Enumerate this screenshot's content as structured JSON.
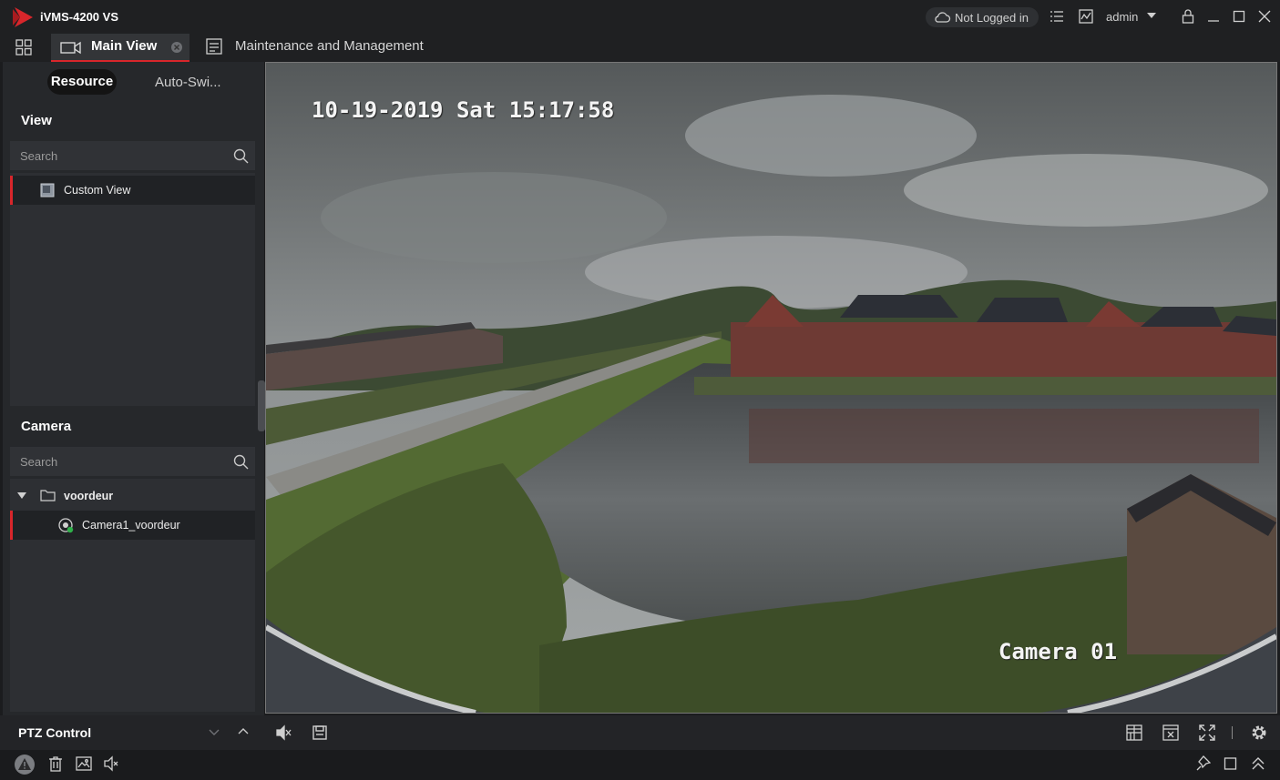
{
  "app": {
    "title": "iVMS-4200 VS",
    "brand_color": "#d8262b"
  },
  "titlebar": {
    "login_status": "Not Logged in",
    "user": "admin",
    "icons": [
      "cloud-icon",
      "task-list-icon",
      "alarm-event-icon",
      "user-dropdown-icon",
      "lock-icon",
      "minimize-icon",
      "maximize-icon",
      "close-icon"
    ]
  },
  "tabs": {
    "main_view": "Main View",
    "maintenance": "Maintenance and Management"
  },
  "left_panel": {
    "tab_resource": "Resource",
    "tab_autoswitch": "Auto-Swi...",
    "view_section": {
      "title": "View",
      "search_placeholder": "Search",
      "items": [
        {
          "label": "Custom View"
        }
      ]
    },
    "camera_section": {
      "title": "Camera",
      "search_placeholder": "Search",
      "group": "voordeur",
      "cameras": [
        {
          "label": "Camera1_voordeur"
        }
      ]
    },
    "ptz_label": "PTZ Control"
  },
  "video": {
    "osd_datetime": "10-19-2019 Sat 15:17:58",
    "osd_camera": "Camera 01"
  },
  "bottom_toolbar": {
    "left_icons": [
      "audio-off-icon",
      "save-icon"
    ],
    "right_icons": [
      "window-division-icon",
      "close-all-windows-icon",
      "fullscreen-icon",
      "settings-icon"
    ]
  },
  "statusbar": {
    "left_icons": [
      "alarm-warning-icon",
      "trash-icon",
      "picture-icon",
      "sound-icon"
    ],
    "right_icons": [
      "pin-icon",
      "window-icon",
      "collapse-up-icon"
    ]
  }
}
